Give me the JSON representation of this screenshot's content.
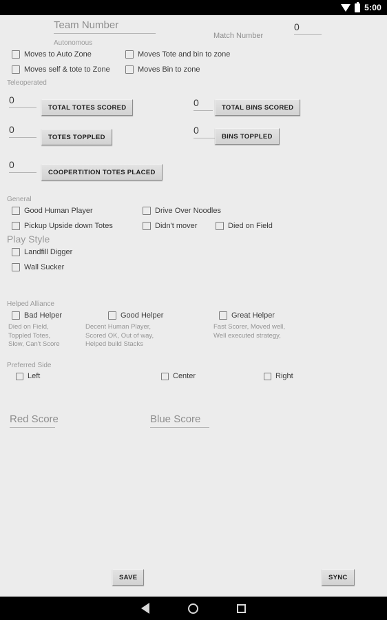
{
  "statusbar": {
    "time": "5:00",
    "wifi_icon": "wifi-icon",
    "battery_icon": "battery-icon"
  },
  "form": {
    "team_number": {
      "placeholder": "Team Number"
    },
    "match_number": {
      "label": "Match Number",
      "value": "0"
    },
    "sections": {
      "autonomous": "Autonomous",
      "teleoperated": "Teleoperated",
      "general": "General",
      "play_style": "Play Style",
      "helped_alliance": "Helped Alliance",
      "preferred_side": "Preferred Side"
    },
    "autonomous_checks": [
      {
        "label": "Moves to Auto Zone",
        "checked": false
      },
      {
        "label": "Moves Tote and bin to zone",
        "checked": false
      },
      {
        "label": "Moves self & tote to Zone",
        "checked": false
      },
      {
        "label": "Moves Bin to zone",
        "checked": false
      }
    ],
    "counters": [
      {
        "value": "0",
        "button": "TOTAL TOTES SCORED"
      },
      {
        "value": "0",
        "button": "TOTAL BINS SCORED"
      },
      {
        "value": "0",
        "button": "TOTES TOPPLED"
      },
      {
        "value": "0",
        "button": "BINS TOPPLED"
      },
      {
        "value": "0",
        "button": "COOPERTITION TOTES PLACED"
      }
    ],
    "general_checks": [
      {
        "label": "Good Human Player",
        "checked": false
      },
      {
        "label": "Drive Over Noodles",
        "checked": false
      },
      {
        "label": "Pickup Upside down Totes",
        "checked": false
      },
      {
        "label": "Didn't mover",
        "checked": false
      },
      {
        "label": "Died on Field",
        "checked": false
      }
    ],
    "play_style_checks": [
      {
        "label": "Landfill Digger",
        "checked": false
      },
      {
        "label": "Wall Sucker",
        "checked": false
      }
    ],
    "helpers": [
      {
        "label": "Bad Helper",
        "desc": "Died on Field,\nToppled Totes,\nSlow, Can't Score",
        "checked": false
      },
      {
        "label": "Good Helper",
        "desc": "Decent Human Player,\nScored OK, Out of way,\nHelped build Stacks",
        "checked": false
      },
      {
        "label": "Great Helper",
        "desc": "Fast Scorer, Moved well,\nWell executed strategy,",
        "checked": false
      }
    ],
    "sides": [
      {
        "label": "Left",
        "checked": false
      },
      {
        "label": "Center",
        "checked": false
      },
      {
        "label": "Right",
        "checked": false
      }
    ],
    "red_score": {
      "placeholder": "Red Score"
    },
    "blue_score": {
      "placeholder": "Blue Score"
    },
    "save_button": "SAVE",
    "sync_button": "SYNC"
  },
  "navbar": {
    "back": "back-icon",
    "home": "home-icon",
    "recents": "recents-icon"
  },
  "colors": {
    "background": "#ececec",
    "muted_text": "#9a9a9a",
    "body_text": "#3c3c3c",
    "button_face": "#d8d8d8"
  }
}
